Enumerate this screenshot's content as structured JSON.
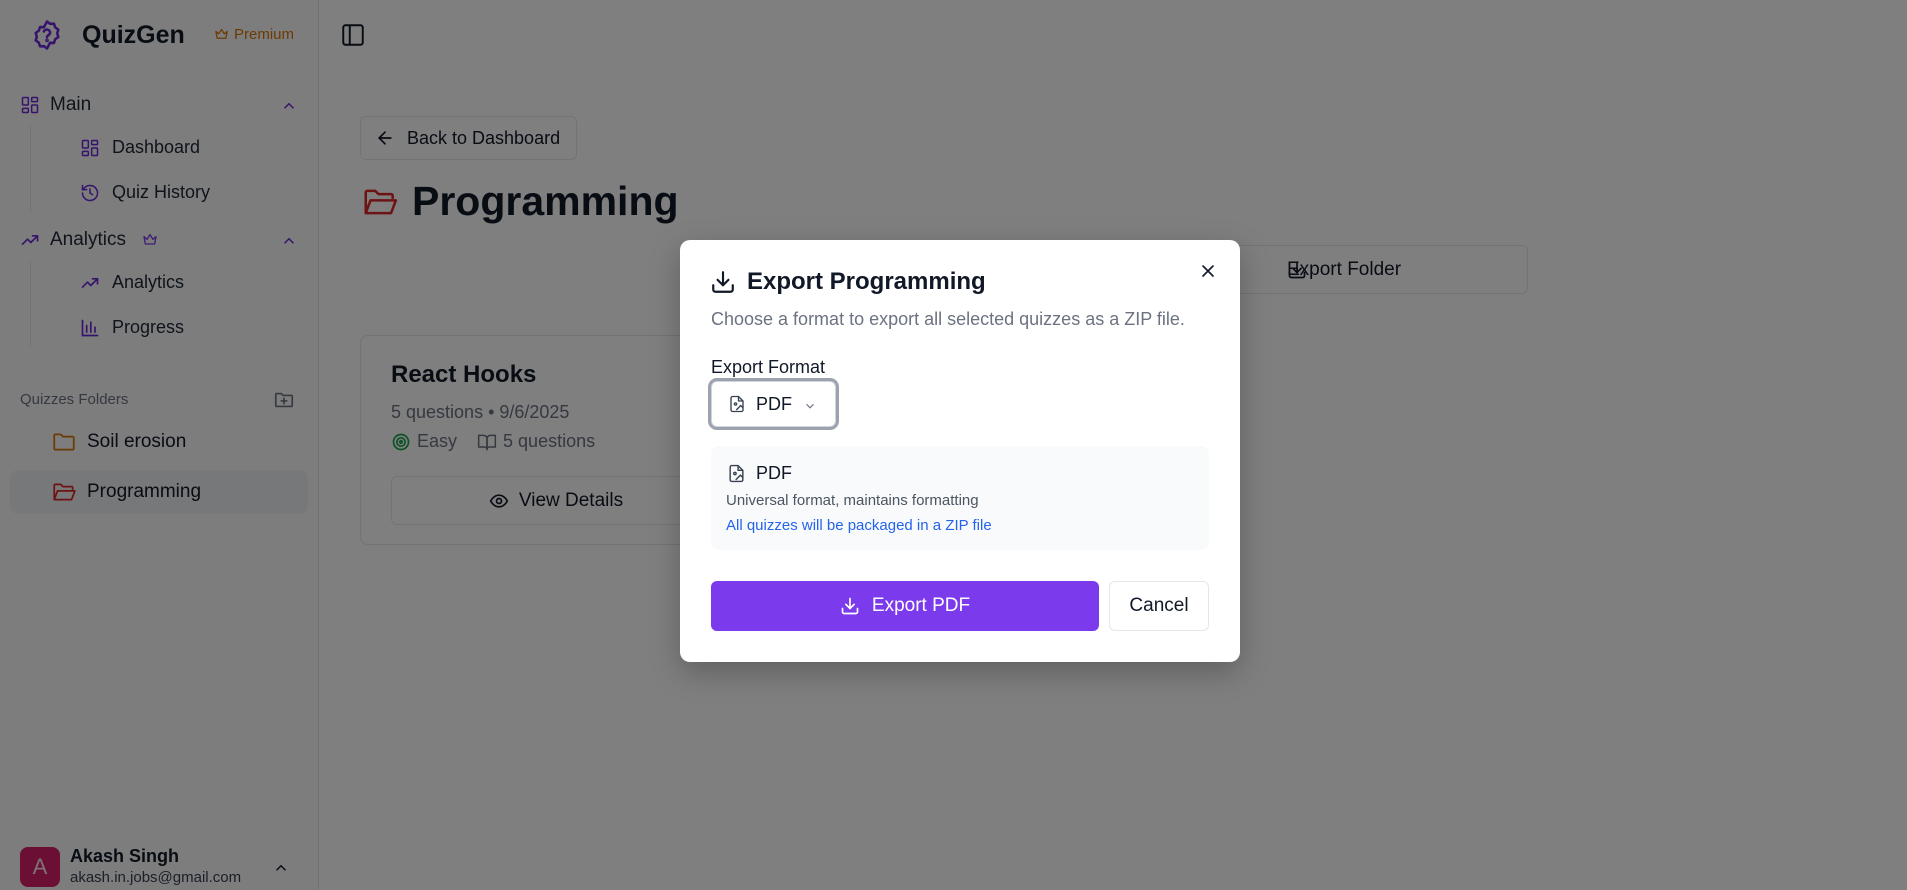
{
  "app": {
    "name": "QuizGen",
    "plan_badge": "Premium"
  },
  "sidebar": {
    "groups": [
      {
        "label": "Main",
        "items": [
          {
            "label": "Dashboard",
            "icon": "layout-grid-icon"
          },
          {
            "label": "Quiz History",
            "icon": "history-icon"
          }
        ]
      },
      {
        "label": "Analytics",
        "items": [
          {
            "label": "Analytics",
            "icon": "trending-up-icon"
          },
          {
            "label": "Progress",
            "icon": "bar-chart-icon"
          }
        ]
      }
    ],
    "folders_title": "Quizzes Folders",
    "folders": [
      {
        "label": "Soil erosion",
        "active": false
      },
      {
        "label": "Programming",
        "active": true
      }
    ],
    "user": {
      "initial": "A",
      "name": "Akash Singh",
      "email": "akash.in.jobs@gmail.com"
    }
  },
  "main": {
    "back_label": "Back to Dashboard",
    "title": "Programming",
    "export_folder_label": "Export Folder",
    "quiz_card": {
      "title": "React Hooks",
      "meta": "5 questions • 9/6/2025",
      "difficulty": "Easy",
      "questions_tag": "5 questions",
      "view_label": "View Details"
    }
  },
  "modal": {
    "title": "Export Programming",
    "description": "Choose a format to export all selected quizzes as a ZIP file.",
    "format_label": "Export Format",
    "selected_format": "PDF",
    "info": {
      "name": "PDF",
      "description": "Universal format, maintains formatting",
      "note": "All quizzes will be packaged in a ZIP file"
    },
    "primary_label": "Export PDF",
    "cancel_label": "Cancel"
  },
  "colors": {
    "accent": "#7c3aed",
    "premium": "#d97706",
    "folder_active": "#dc2626",
    "folder": "#d97706",
    "note": "#2563eb",
    "easy": "#16a34a"
  }
}
